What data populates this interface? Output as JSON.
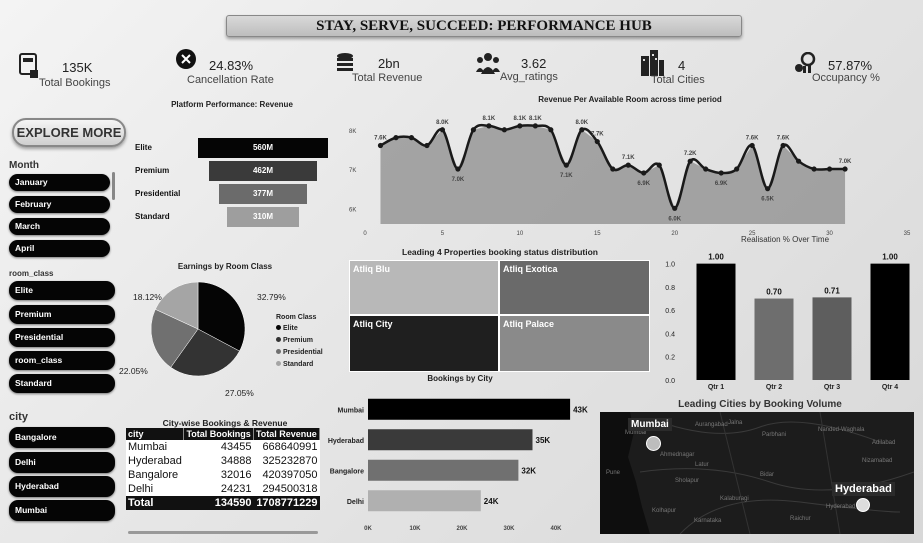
{
  "title": "STAY, SERVE, SUCCEED: PERFORMANCE HUB",
  "kpis": [
    {
      "value": "135K",
      "label": "Total Bookings",
      "icon": "booking-icon"
    },
    {
      "value": "24.83%",
      "label": "Cancellation Rate",
      "icon": "cancel-icon"
    },
    {
      "value": "2bn",
      "label": "Total Revenue",
      "icon": "coins-icon"
    },
    {
      "value": "3.62",
      "label": "Avg_ratings",
      "icon": "people-icon"
    },
    {
      "value": "4",
      "label": "Total Cities",
      "icon": "buildings-icon"
    },
    {
      "value": "57.87%",
      "label": "Occupancy %",
      "icon": "occupancy-icon"
    }
  ],
  "explore_button": "EXPLORE MORE",
  "slicers": {
    "month": {
      "title": "Month",
      "items": [
        "January",
        "February",
        "March",
        "April"
      ]
    },
    "room_class": {
      "title": "room_class",
      "items": [
        "Elite",
        "Premium",
        "Presidential",
        "room_class",
        "Standard"
      ]
    },
    "city": {
      "title": "city",
      "items": [
        "Bangalore",
        "Delhi",
        "Hyderabad",
        "Mumbai"
      ]
    }
  },
  "funnel": {
    "title": "Platform Performance: Revenue",
    "chart_data": {
      "type": "bar",
      "categories": [
        "Elite",
        "Premium",
        "Presidential",
        "Standard"
      ],
      "values": [
        560,
        462,
        377,
        310
      ],
      "labels": [
        "560M",
        "462M",
        "377M",
        "310M"
      ],
      "colors": [
        "#050505",
        "#3a3a3a",
        "#6b6b6b",
        "#9e9e9e"
      ]
    }
  },
  "revpar": {
    "title": "Revenue Per Available Room across time period",
    "chart_data": {
      "type": "line",
      "x": [
        1,
        2,
        3,
        4,
        5,
        6,
        7,
        8,
        9,
        10,
        11,
        12,
        13,
        14,
        15,
        16,
        17,
        18,
        19,
        20,
        21,
        22,
        23,
        24,
        25,
        26,
        27,
        28,
        29,
        30,
        31
      ],
      "y": [
        7.6,
        7.8,
        7.8,
        7.6,
        8.0,
        7.0,
        8.0,
        8.1,
        8.0,
        8.1,
        8.1,
        8.0,
        7.1,
        8.0,
        7.7,
        7.0,
        7.1,
        6.9,
        7.1,
        6.0,
        7.2,
        7.0,
        6.9,
        7.0,
        7.6,
        6.5,
        7.6,
        7.2,
        7.0,
        7.0,
        7.0
      ],
      "point_labels": [
        {
          "x": 1,
          "label": "7.6K"
        },
        {
          "x": 5,
          "label": "8.0K"
        },
        {
          "x": 6,
          "label": "7.0K"
        },
        {
          "x": 8,
          "label": "8.1K"
        },
        {
          "x": 10,
          "label": "8.1K"
        },
        {
          "x": 11,
          "label": "8.1K"
        },
        {
          "x": 13,
          "label": "7.1K"
        },
        {
          "x": 14,
          "label": "8.0K"
        },
        {
          "x": 15,
          "label": "7.7K"
        },
        {
          "x": 17,
          "label": "7.1K"
        },
        {
          "x": 18,
          "label": "6.9K"
        },
        {
          "x": 20,
          "label": "6.0K"
        },
        {
          "x": 21,
          "label": "7.2K"
        },
        {
          "x": 23,
          "label": "6.9K"
        },
        {
          "x": 25,
          "label": "7.6K"
        },
        {
          "x": 26,
          "label": "6.5K"
        },
        {
          "x": 27,
          "label": "7.6K"
        },
        {
          "x": 31,
          "label": "7.0K"
        }
      ],
      "xticks": [
        "0",
        "5",
        "10",
        "15",
        "20",
        "25",
        "30",
        "35"
      ],
      "yticks": [
        "6K",
        "7K",
        "8K"
      ],
      "xlim": [
        0,
        35
      ],
      "ylim": [
        5.6,
        8.3
      ]
    }
  },
  "pie": {
    "title": "Earnings by Room Class",
    "chart_data": {
      "type": "pie",
      "categories": [
        "Elite",
        "Premium",
        "Presidential",
        "Standard"
      ],
      "values": [
        32.79,
        27.05,
        22.05,
        18.12
      ],
      "labels": [
        "32.79%",
        "27.05%",
        "22.05%",
        "18.12%"
      ],
      "colors": [
        "#050505",
        "#333333",
        "#707070",
        "#a5a5a5"
      ]
    },
    "legend_title": "Room Class"
  },
  "treemap": {
    "title": "Leading 4 Properties booking status distribution",
    "items": [
      {
        "name": "Atliq Blu",
        "color": "#b8b8b8"
      },
      {
        "name": "Atliq Exotica",
        "color": "#6a6a6a"
      },
      {
        "name": "Atliq City",
        "color": "#1f1f1f"
      },
      {
        "name": "Atliq Palace",
        "color": "#8a8a8a"
      }
    ]
  },
  "realisation": {
    "title": "Realisation % Over Time",
    "chart_data": {
      "type": "bar",
      "categories": [
        "Qtr 1",
        "Qtr 2",
        "Qtr 3",
        "Qtr 4"
      ],
      "values": [
        1.0,
        0.7,
        0.71,
        1.0
      ],
      "labels": [
        "1.00",
        "0.70",
        "0.71",
        "1.00"
      ],
      "colors": [
        "#000000",
        "#6e6e6e",
        "#5e5e5e",
        "#000000"
      ],
      "yticks": [
        "0.0",
        "0.2",
        "0.4",
        "0.6",
        "0.8",
        "1.0"
      ],
      "ylim": [
        0,
        1.1
      ]
    }
  },
  "city_table": {
    "title": "City-wise Bookings & Revenue",
    "headers": [
      "city",
      "Total Bookings",
      "Total Revenue"
    ],
    "rows": [
      [
        "Mumbai",
        "43455",
        "668640991"
      ],
      [
        "Hyderabad",
        "34888",
        "325232870"
      ],
      [
        "Bangalore",
        "32016",
        "420397050"
      ],
      [
        "Delhi",
        "24231",
        "294500318"
      ]
    ],
    "total": [
      "Total",
      "134590",
      "1708771229"
    ]
  },
  "bookings_by_city": {
    "title": "Bookings by City",
    "chart_data": {
      "type": "bar",
      "categories": [
        "Mumbai",
        "Hyderabad",
        "Bangalore",
        "Delhi"
      ],
      "values": [
        43,
        35,
        32,
        24
      ],
      "labels": [
        "43K",
        "35K",
        "32K",
        "24K"
      ],
      "colors": [
        "#000000",
        "#3a3a3a",
        "#707070",
        "#b0b0b0"
      ],
      "xticks": [
        "0K",
        "10K",
        "20K",
        "30K",
        "40K"
      ],
      "xlim": [
        0,
        40
      ]
    }
  },
  "map": {
    "title": "Leading Cities by Booking Volume",
    "labels": [
      "Mumbai",
      "Hyderabad"
    ],
    "place_names": [
      "Mumbai",
      "Pune",
      "Ahmednagar",
      "Aurangabad",
      "Jalna",
      "Parbhani",
      "Latur",
      "Nanded-Waghala",
      "Adilabad",
      "Nizamabad",
      "Sholapur",
      "Bidar",
      "Hyderabad",
      "Kalaburagi",
      "Kolhapur",
      "Raichur",
      "Karnataka"
    ]
  }
}
